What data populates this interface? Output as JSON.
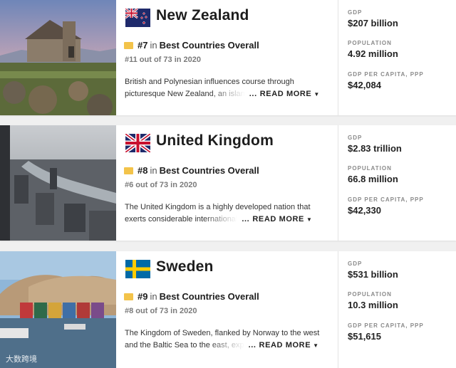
{
  "cards": [
    {
      "country": "New Zealand",
      "rank": "#7",
      "in_word": "in",
      "category": "Best Countries Overall",
      "previous": "#11 out of 73 in 2020",
      "desc_line1": "British and Polynesian influences course through",
      "desc_line2": "picturesque New Zealand, an islan",
      "more": "READ MORE",
      "stats": [
        {
          "label": "GDP",
          "value": "$207 billion"
        },
        {
          "label": "POPULATION",
          "value": "4.92 million"
        },
        {
          "label": "GDP PER CAPITA, PPP",
          "value": "$42,084"
        }
      ]
    },
    {
      "country": "United Kingdom",
      "rank": "#8",
      "in_word": "in",
      "category": "Best Countries Overall",
      "previous": "#6 out of 73 in 2020",
      "desc_line1": "The United Kingdom is a highly developed nation that",
      "desc_line2": "exerts considerable international",
      "more": "READ MORE",
      "stats": [
        {
          "label": "GDP",
          "value": "$2.83 trillion"
        },
        {
          "label": "POPULATION",
          "value": "66.8 million"
        },
        {
          "label": "GDP PER CAPITA, PPP",
          "value": "$42,330"
        }
      ]
    },
    {
      "country": "Sweden",
      "rank": "#9",
      "in_word": "in",
      "category": "Best Countries Overall",
      "previous": "#8 out of 73 in 2020",
      "desc_line1": "The Kingdom of Sweden, flanked by Norway to the west",
      "desc_line2": "and the Baltic Sea to the east, exp",
      "more": "READ MORE",
      "stats": [
        {
          "label": "GDP",
          "value": "$531 billion"
        },
        {
          "label": "POPULATION",
          "value": "10.3 million"
        },
        {
          "label": "GDP PER CAPITA, PPP",
          "value": "$51,615"
        }
      ]
    }
  ],
  "watermark": "大数跨境",
  "colors": {
    "trophy": "#f3c34a",
    "text": "#1d1d1d",
    "label": "#8a8a8a"
  }
}
